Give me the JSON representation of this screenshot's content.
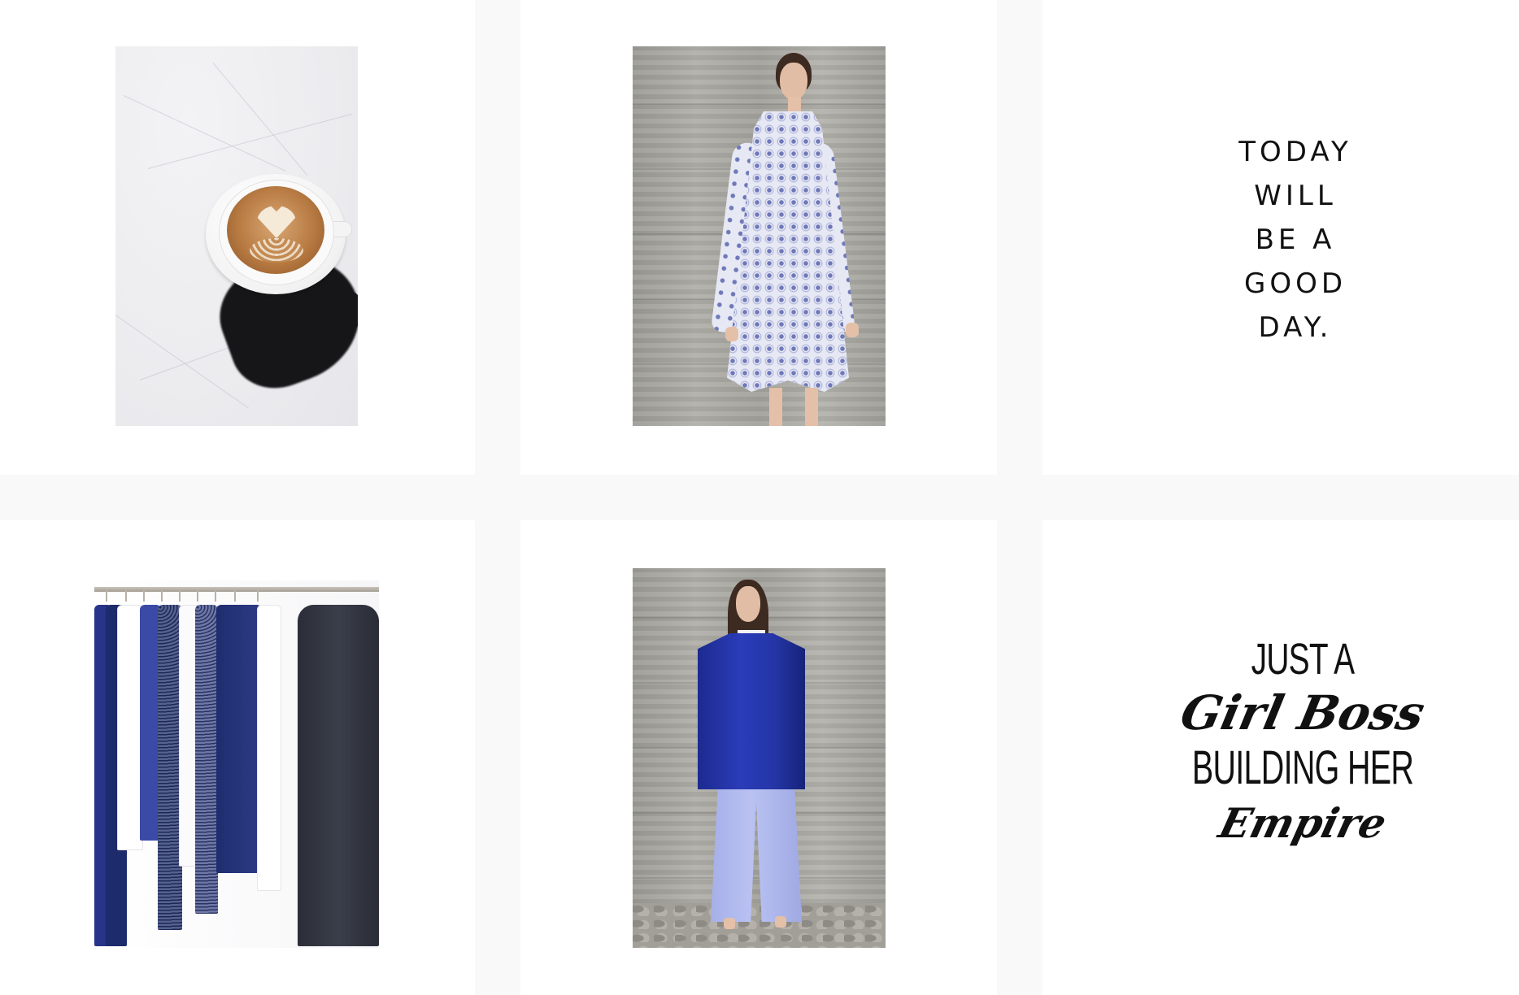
{
  "feed": {
    "tiles": [
      {
        "kind": "photo",
        "subject": "latte-art-coffee-cup"
      },
      {
        "kind": "photo",
        "subject": "model-in-printed-dress"
      },
      {
        "kind": "quote",
        "lines": [
          "TODAY",
          "WILL",
          "BE A",
          "GOOD",
          "DAY."
        ]
      },
      {
        "kind": "photo",
        "subject": "clothing-rack"
      },
      {
        "kind": "photo",
        "subject": "model-in-blue-coat"
      },
      {
        "kind": "quote",
        "lines": [
          "JUST A",
          "Girl Boss",
          "BUILDING HER",
          "Empire"
        ]
      }
    ]
  },
  "colors": {
    "page_background": "#f9f9f9",
    "tile_background": "#ffffff",
    "text": "#111111",
    "coat_blue": "#2536a8",
    "pants_lavender": "#b0baf0"
  }
}
